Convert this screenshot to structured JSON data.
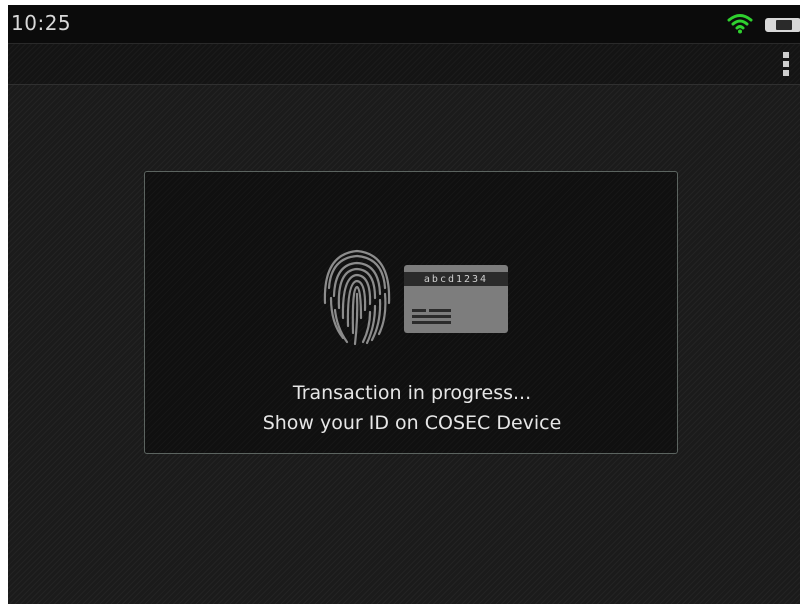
{
  "status_bar": {
    "time": "10:25",
    "wifi_icon": "wifi-icon",
    "battery_icon": "battery-icon",
    "wifi_color": "#2fd12f"
  },
  "toolbar": {
    "overflow_icon": "more-vertical-icon"
  },
  "dialog": {
    "fingerprint_icon": "fingerprint-icon",
    "card_icon": "id-card-icon",
    "card_number": "abcd1234",
    "message_line_1": "Transaction in progress...",
    "message_line_2": "Show your ID on COSEC Device"
  }
}
